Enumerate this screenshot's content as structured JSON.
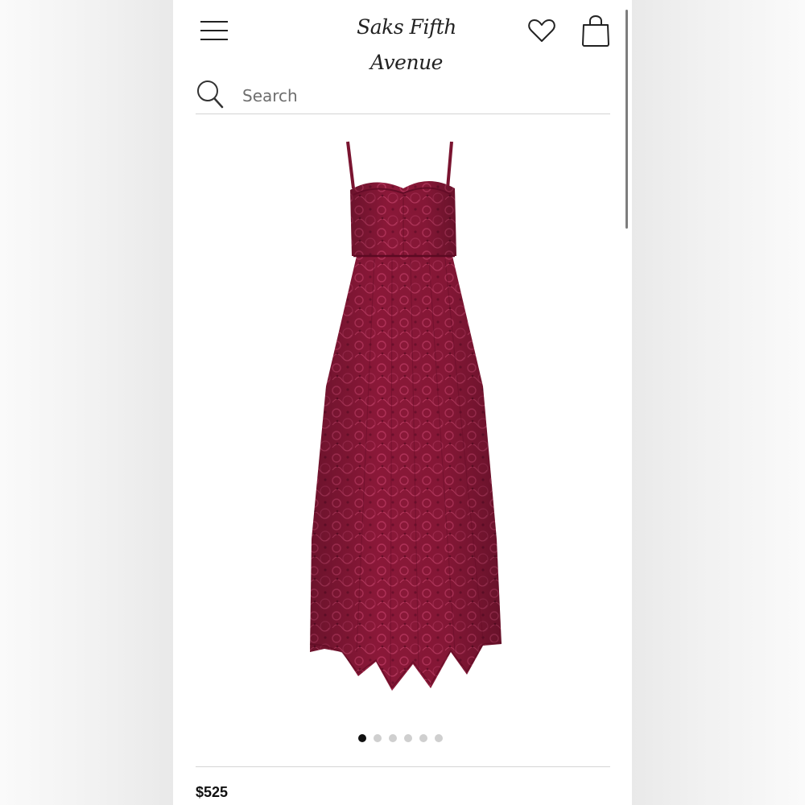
{
  "header": {
    "logo_text": "Saks Fifth Avenue",
    "menu_icon": "hamburger-menu-icon",
    "wishlist_icon": "heart-icon",
    "bag_icon": "shopping-bag-icon"
  },
  "search": {
    "placeholder": "Search",
    "value": "",
    "icon": "search-icon"
  },
  "product": {
    "image": "burgundy lace midi dress with sweetheart neckline and spaghetti straps",
    "dress_color": "#8a1838",
    "carousel": {
      "total": 6,
      "active_index": 1
    },
    "price": "$525"
  }
}
